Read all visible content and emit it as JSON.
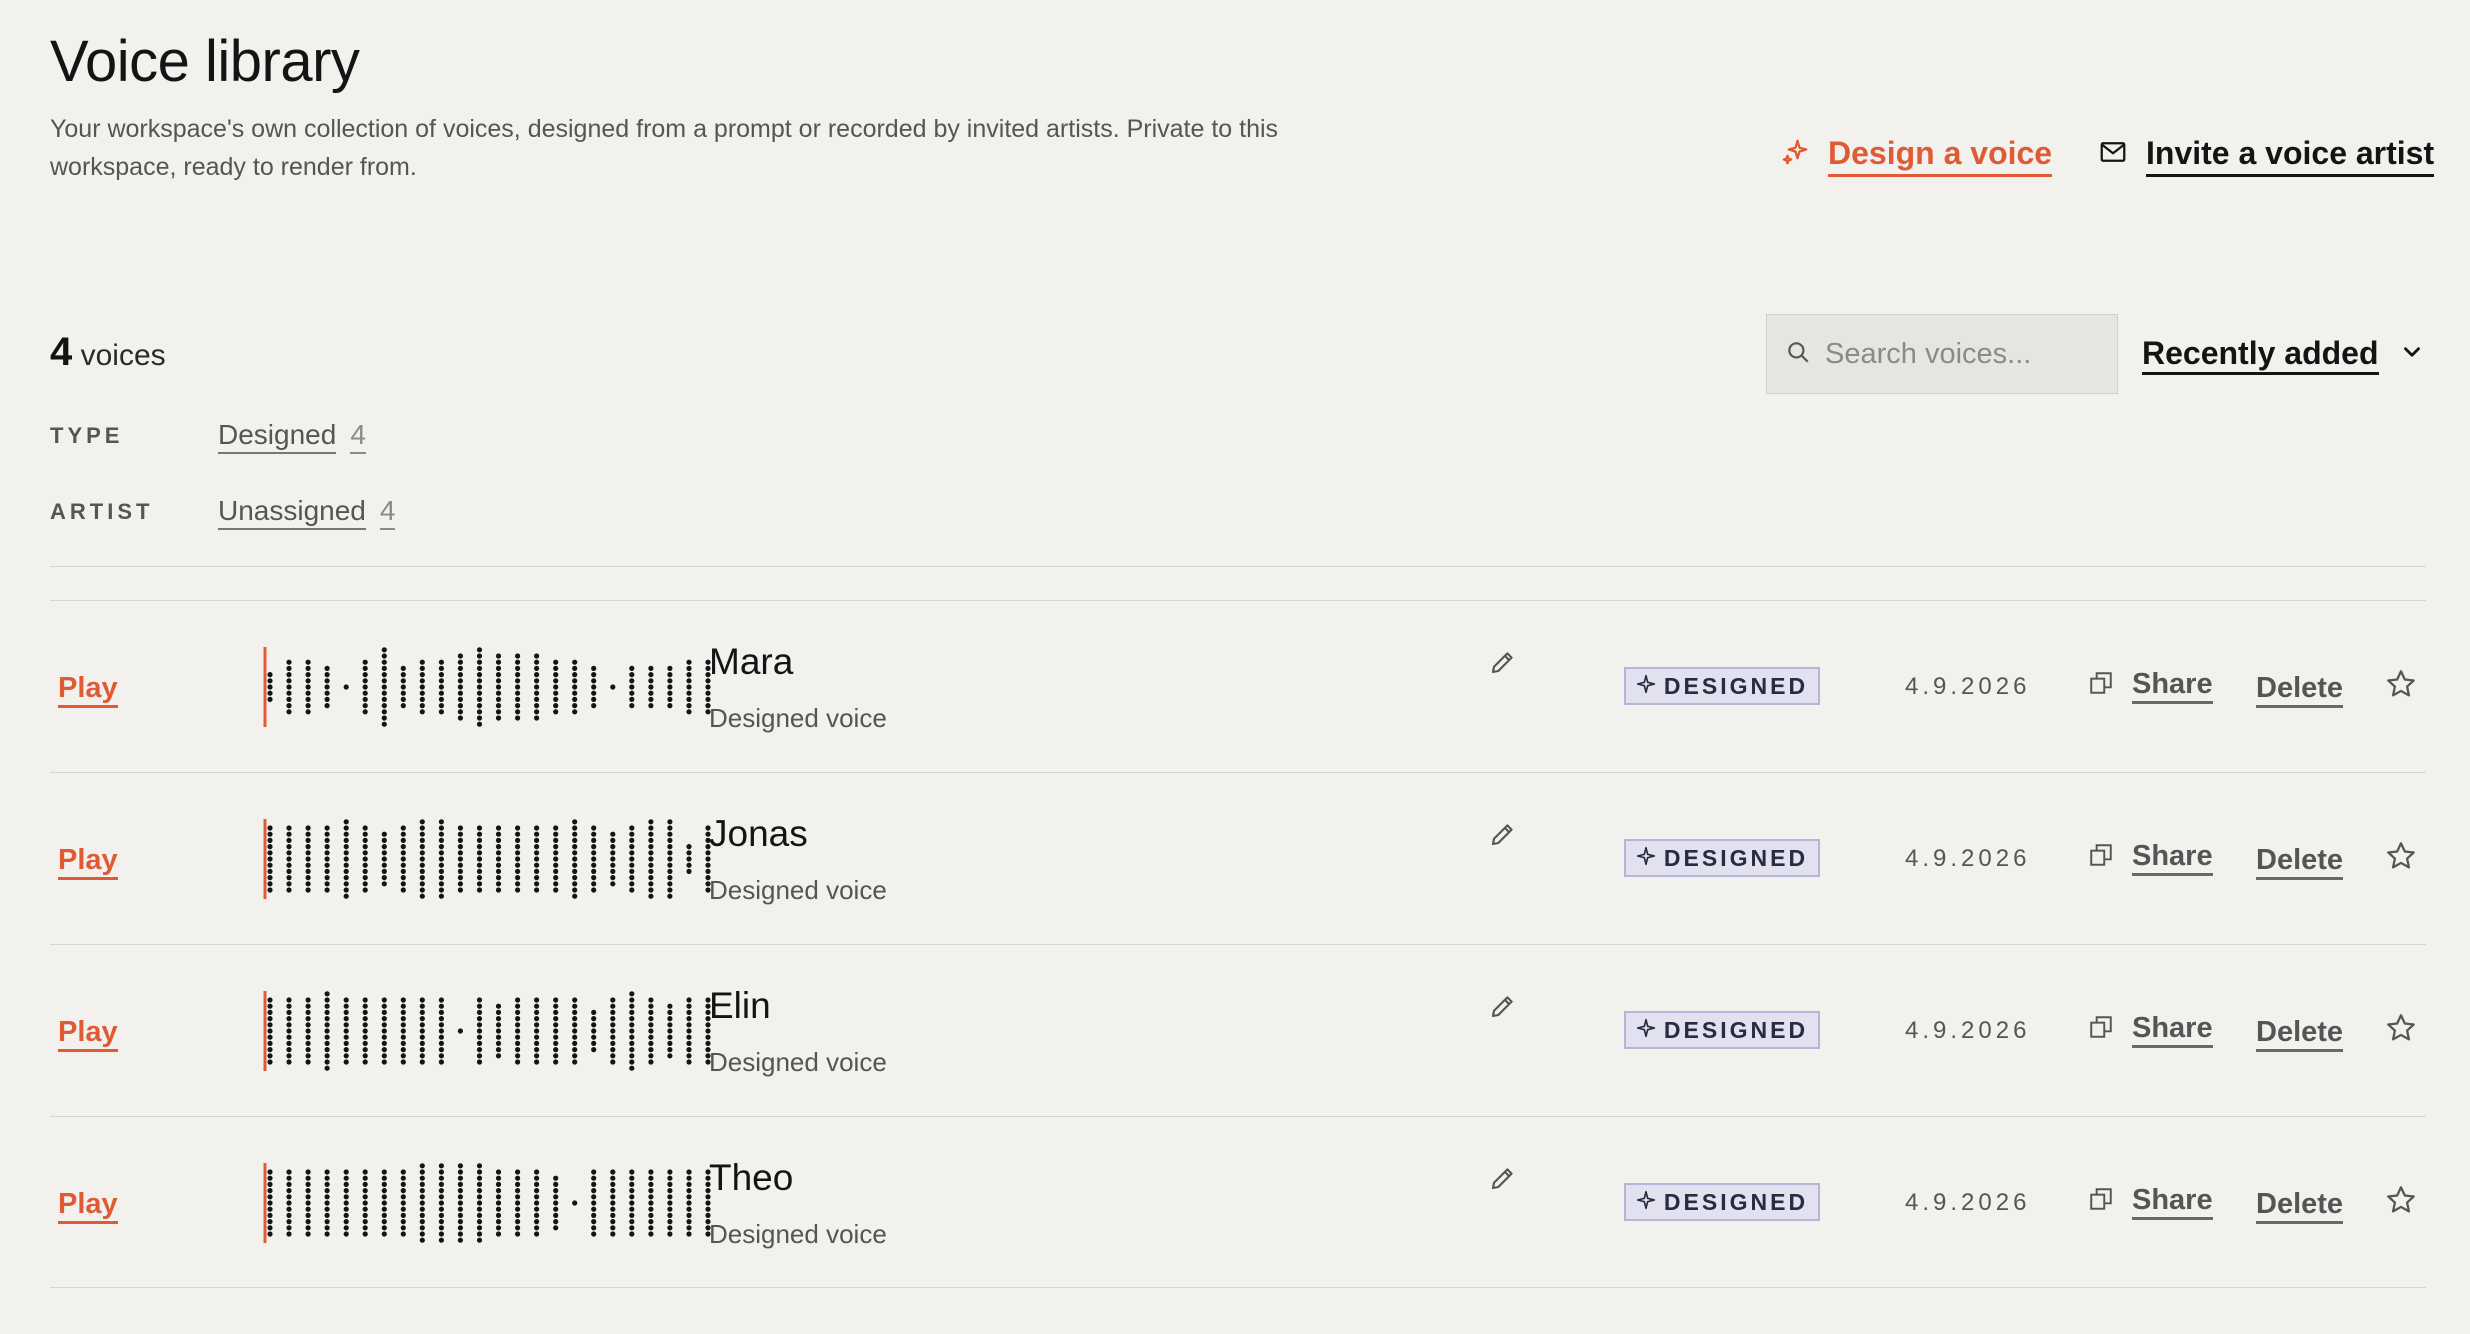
{
  "header": {
    "title": "Voice library",
    "subtitle": "Your workspace's own collection of voices, designed from a prompt or recorded by invited artists. Private to this workspace, ready to render from.",
    "design_label": "Design a voice",
    "invite_label": "Invite a voice artist"
  },
  "toolbar": {
    "count_number": "4",
    "count_unit": "voices",
    "search_placeholder": "Search voices...",
    "sort_label": "Recently added"
  },
  "filters": [
    {
      "key": "TYPE",
      "value": "Designed",
      "count": "4"
    },
    {
      "key": "ARTIST",
      "value": "Unassigned",
      "count": "4"
    }
  ],
  "voices": [
    {
      "play": "Play",
      "name": "Mara",
      "subtitle": "Designed voice",
      "badge": "DESIGNED",
      "date": "4.9.2026",
      "share": "Share",
      "delete": "Delete",
      "waveform": [
        0.35,
        0.6,
        0.6,
        0.45,
        0.05,
        0.55,
        0.95,
        0.45,
        0.55,
        0.55,
        0.75,
        0.95,
        0.85,
        0.75,
        0.7,
        0.55,
        0.55,
        0.45,
        0.05,
        0.5,
        0.5,
        0.45,
        0.55,
        0.55
      ]
    },
    {
      "play": "Play",
      "name": "Jonas",
      "subtitle": "Designed voice",
      "badge": "DESIGNED",
      "date": "4.9.2026",
      "share": "Share",
      "delete": "Delete",
      "waveform": [
        0.7,
        0.8,
        0.8,
        0.8,
        0.9,
        0.8,
        0.6,
        0.8,
        0.9,
        0.9,
        0.85,
        0.8,
        0.8,
        0.75,
        0.8,
        0.8,
        0.9,
        0.8,
        0.6,
        0.8,
        0.9,
        0.95,
        0.25,
        0.8
      ]
    },
    {
      "play": "Play",
      "name": "Elin",
      "subtitle": "Designed voice",
      "badge": "DESIGNED",
      "date": "4.9.2026",
      "share": "Share",
      "delete": "Delete",
      "waveform": [
        0.85,
        0.85,
        0.8,
        0.9,
        0.8,
        0.8,
        0.8,
        0.8,
        0.8,
        0.85,
        0.05,
        0.8,
        0.6,
        0.8,
        0.8,
        0.75,
        0.8,
        0.45,
        0.8,
        0.95,
        0.8,
        0.6,
        0.8,
        0.8
      ]
    },
    {
      "play": "Play",
      "name": "Theo",
      "subtitle": "Designed voice",
      "badge": "DESIGNED",
      "date": "4.9.2026",
      "share": "Share",
      "delete": "Delete",
      "waveform": [
        0.8,
        0.8,
        0.8,
        0.8,
        0.8,
        0.8,
        0.8,
        0.8,
        0.9,
        0.95,
        0.9,
        0.9,
        0.8,
        0.8,
        0.8,
        0.6,
        0.05,
        0.8,
        0.8,
        0.8,
        0.8,
        0.8,
        0.8,
        0.8
      ]
    }
  ],
  "colors": {
    "accent": "#e05a33",
    "background": "#f2f1ee",
    "badge_bg": "#e2e1ef",
    "badge_border": "#b6b6d8"
  },
  "icons": {
    "design": "sparkle-icon",
    "invite": "mail-icon",
    "search": "search-icon",
    "sort": "chevron-down-icon",
    "edit": "pencil-icon",
    "badge": "sparkle-icon",
    "share": "copy-icon",
    "favorite": "star-icon"
  }
}
